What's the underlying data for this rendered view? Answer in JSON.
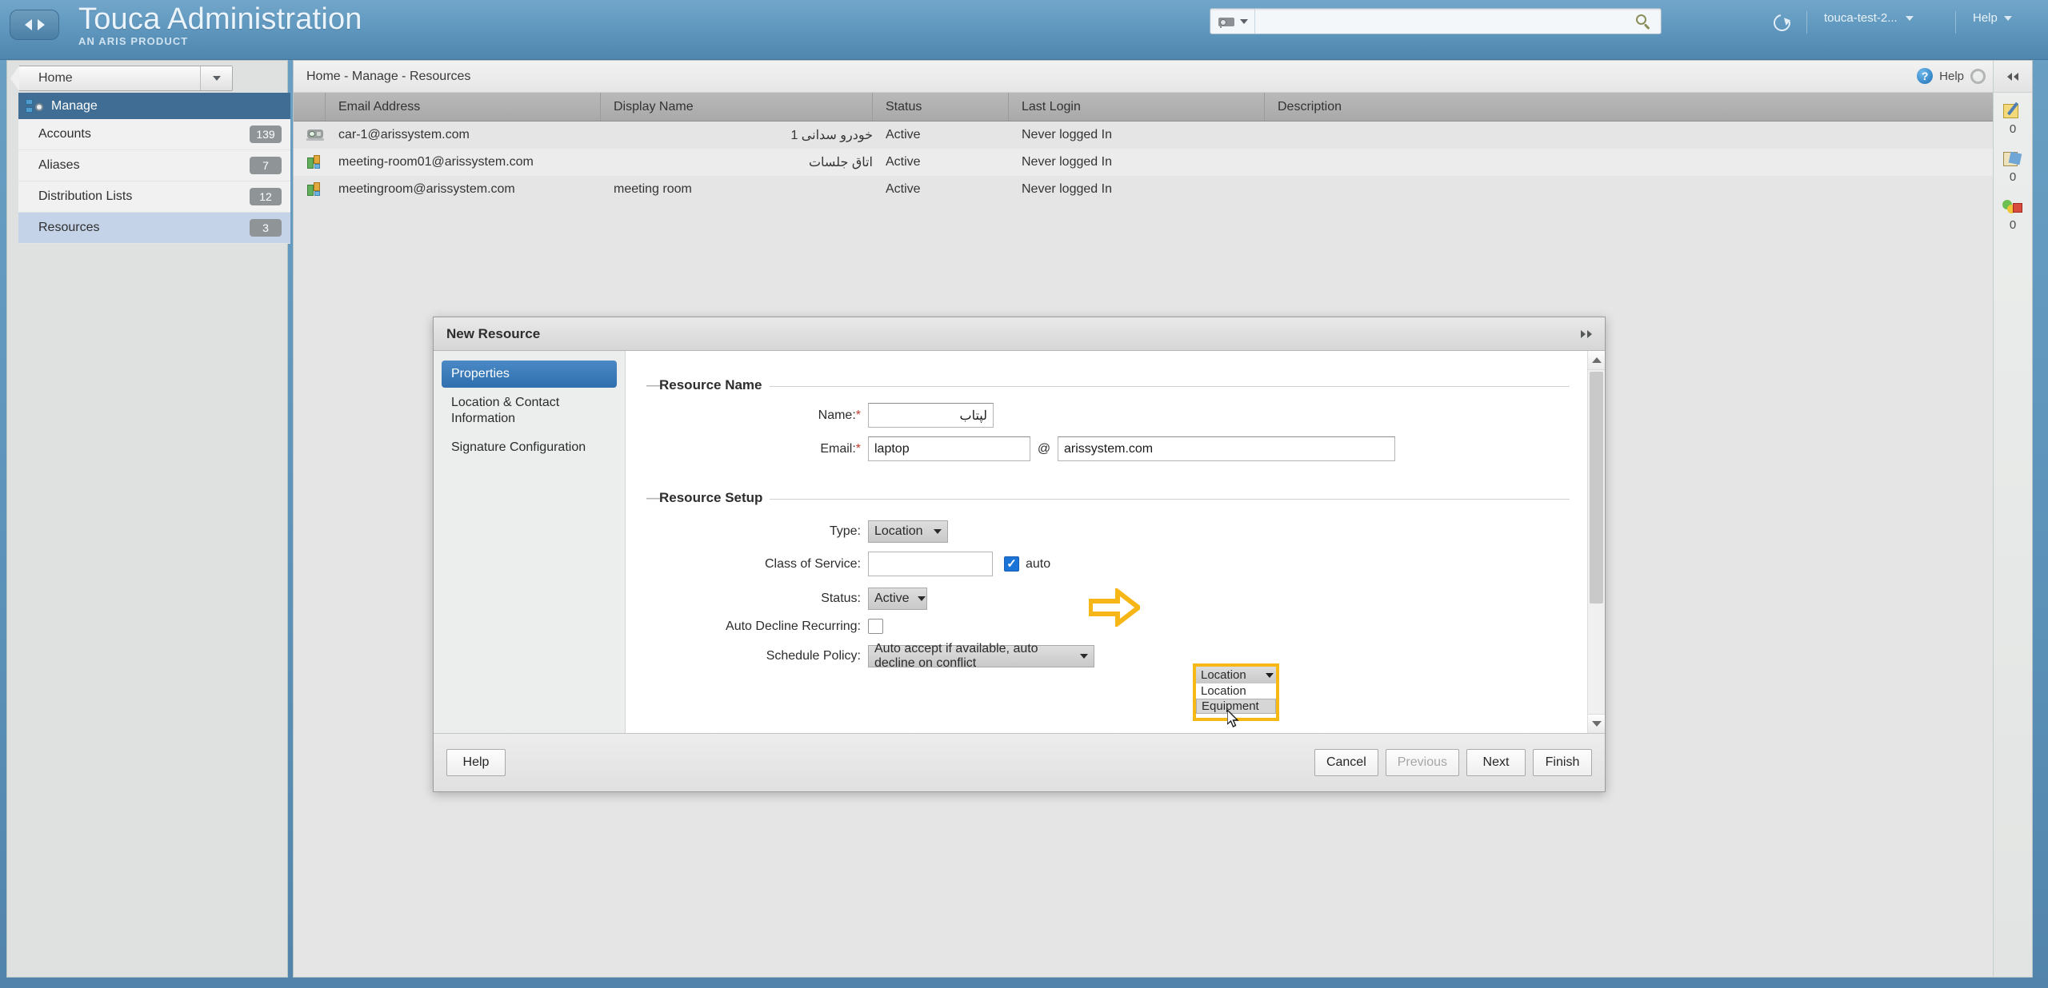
{
  "topbar": {
    "brand_title": "Touca Administration",
    "brand_subtitle": "AN ARIS PRODUCT",
    "search_value": "",
    "search_placeholder": "",
    "search_category_icon": "camera-icon",
    "refresh_icon": "refresh-icon",
    "user_label": "touca-test-2...",
    "help_label": "Help"
  },
  "sidebar": {
    "home_label": "Home",
    "section_label": "Manage",
    "items": [
      {
        "label": "Accounts",
        "count": "139"
      },
      {
        "label": "Aliases",
        "count": "7"
      },
      {
        "label": "Distribution Lists",
        "count": "12"
      },
      {
        "label": "Resources",
        "count": "3"
      }
    ]
  },
  "content": {
    "breadcrumb": "Home - Manage - Resources",
    "help_label": "Help",
    "table": {
      "columns": [
        "Email Address",
        "Display Name",
        "Status",
        "Last Login",
        "Description"
      ],
      "rows": [
        {
          "icon": "car-icon",
          "email": "car-1@arissystem.com",
          "display_name": "خودرو سدانی 1",
          "status": "Active",
          "last_login": "Never logged In",
          "description": ""
        },
        {
          "icon": "meeting-room-icon",
          "email": "meeting-room01@arissystem.com",
          "display_name": "اتاق جلسات",
          "status": "Active",
          "last_login": "Never logged In",
          "description": ""
        },
        {
          "icon": "meeting-room-icon",
          "email": "meetingroom@arissystem.com",
          "display_name": "meeting room",
          "status": "Active",
          "last_login": "Never logged In",
          "description": ""
        }
      ]
    }
  },
  "right_rail": {
    "collapse_icon": "double-left-arrow-icon",
    "items": [
      {
        "icon": "note-pen-icon",
        "count": "0"
      },
      {
        "icon": "task-edit-icon",
        "count": "0"
      },
      {
        "icon": "status-balls-icon",
        "count": "0"
      }
    ]
  },
  "dialog": {
    "title": "New Resource",
    "expand_icon": "double-right-arrow-icon",
    "wizard_tabs": [
      {
        "label": "Properties",
        "active": true
      },
      {
        "label": "Location & Contact Information",
        "active": false
      },
      {
        "label": "Signature Configuration",
        "active": false
      }
    ],
    "resource_name": {
      "legend": "Resource Name",
      "name_label": "Name:",
      "name_value": "لپتاب",
      "email_label": "Email:",
      "email_local_value": "laptop",
      "at_symbol": "@",
      "email_domain_value": "arissystem.com"
    },
    "resource_setup": {
      "legend": "Resource Setup",
      "type_label": "Type:",
      "type_value": "Location",
      "type_options": [
        "Location",
        "Equipment"
      ],
      "type_option_hovered": "Equipment",
      "class_of_service_label": "Class of Service:",
      "class_of_service_value": "",
      "auto_label": "auto",
      "auto_checked": true,
      "status_label": "Status:",
      "status_value": "Active",
      "auto_decline_label": "Auto Decline Recurring:",
      "auto_decline_checked": false,
      "schedule_policy_label": "Schedule Policy:",
      "schedule_policy_value": "Auto accept if available, auto decline on conflict"
    },
    "footer": {
      "help_label": "Help",
      "cancel_label": "Cancel",
      "previous_label": "Previous",
      "previous_disabled": true,
      "next_label": "Next",
      "finish_label": "Finish"
    }
  },
  "colors": {
    "brand_blue": "#5d93ba",
    "accent_blue": "#3f6d93",
    "highlight_yellow": "#f5b814",
    "selected_row": "#c5d3e8",
    "checkbox_blue": "#1a73d6"
  }
}
